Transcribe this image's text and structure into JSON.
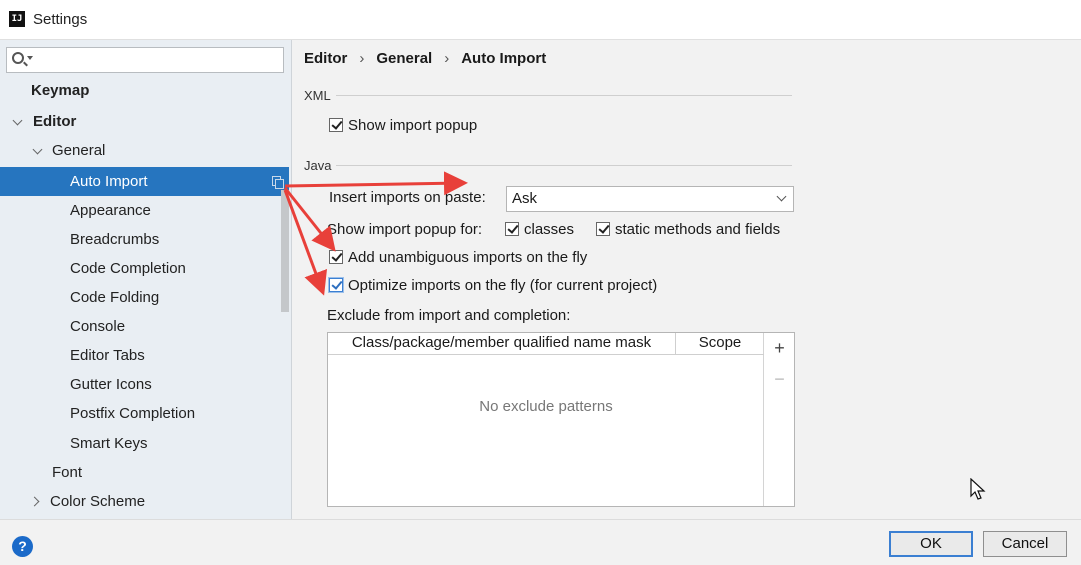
{
  "window": {
    "title": "Settings",
    "app_icon": "IJ"
  },
  "sidebar": {
    "search": {
      "value": "",
      "placeholder": ""
    },
    "items": [
      {
        "label": "Keymap"
      },
      {
        "label": "Editor"
      },
      {
        "label": "General"
      },
      {
        "label": "Auto Import"
      },
      {
        "label": "Appearance"
      },
      {
        "label": "Breadcrumbs"
      },
      {
        "label": "Code Completion"
      },
      {
        "label": "Code Folding"
      },
      {
        "label": "Console"
      },
      {
        "label": "Editor Tabs"
      },
      {
        "label": "Gutter Icons"
      },
      {
        "label": "Postfix Completion"
      },
      {
        "label": "Smart Keys"
      },
      {
        "label": "Font"
      },
      {
        "label": "Color Scheme"
      }
    ],
    "selected": "Auto Import"
  },
  "breadcrumb": [
    "Editor",
    "General",
    "Auto Import"
  ],
  "xml": {
    "section_label": "XML",
    "show_import_popup": {
      "label": "Show import popup",
      "checked": true
    }
  },
  "java": {
    "section_label": "Java",
    "insert_imports_label": "Insert imports on paste:",
    "insert_imports_value": "Ask",
    "show_popup_for_label": "Show import popup for:",
    "classes": {
      "label": "classes",
      "checked": true
    },
    "static_methods": {
      "label": "static methods and fields",
      "checked": true
    },
    "add_unambiguous": {
      "label": "Add unambiguous imports on the fly",
      "checked": true
    },
    "optimize_imports": {
      "label": "Optimize imports on the fly (for current project)",
      "checked": true
    }
  },
  "exclude": {
    "label": "Exclude from import and completion:",
    "columns": [
      "Class/package/member qualified name mask",
      "Scope"
    ],
    "empty_text": "No exclude patterns",
    "add_label": "+",
    "remove_label": "−"
  },
  "buttons": {
    "help": "?",
    "ok": "OK",
    "cancel": "Cancel"
  },
  "colors": {
    "selection": "#2675bf",
    "annotation_arrow": "#e8403a",
    "accent": "#3b7fd2"
  }
}
